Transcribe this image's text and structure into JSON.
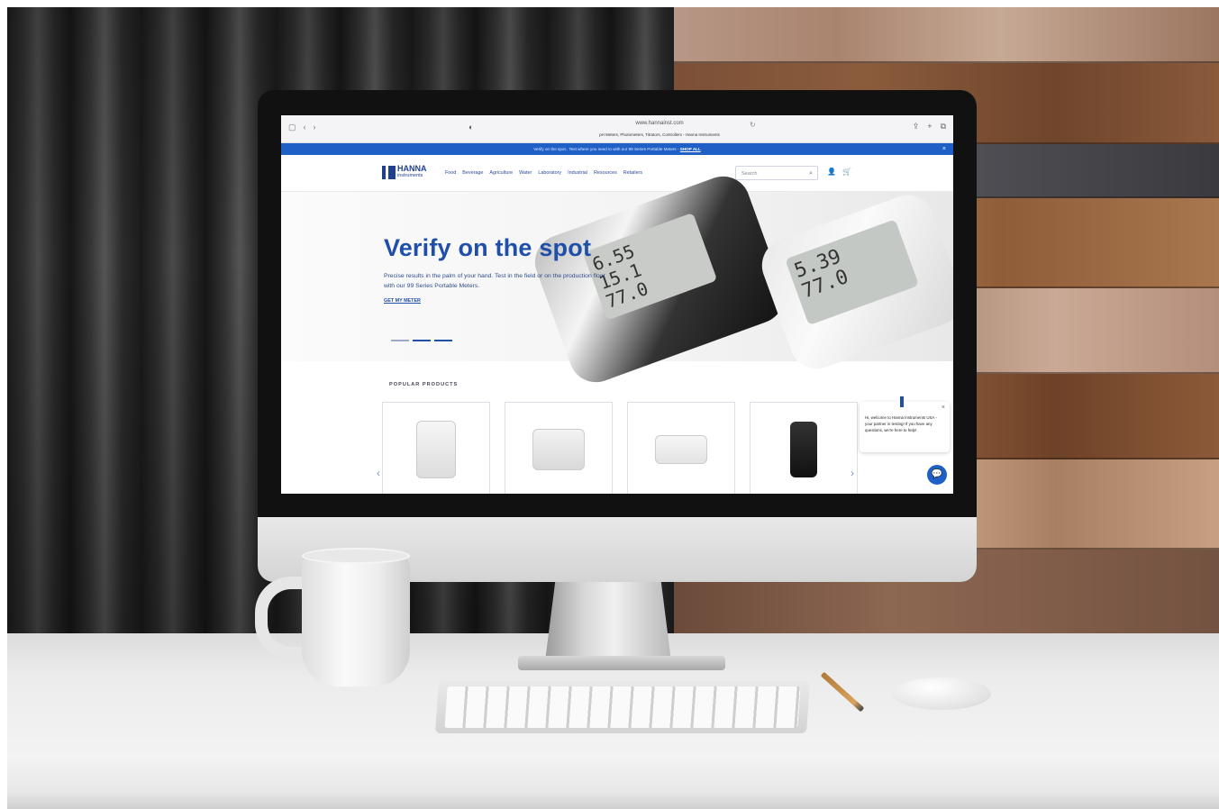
{
  "browser": {
    "url": "www.hannainst.com",
    "tab_title": "pH Meters, Photometers, Titrators, Controllers - Hanna Instruments",
    "nav_back": "‹",
    "nav_forward": "›",
    "sidebar_icon": "▢",
    "shield_icon": "◐",
    "reload_icon": "↻",
    "share_icon": "⇪",
    "new_tab_icon": "+",
    "tabs_icon": "⧉"
  },
  "promo": {
    "text": "Verify on the spot.. Test where you need to with our 99 Series Portable Meters - ",
    "link": "SHOP ALL",
    "close": "×"
  },
  "site": {
    "logo_text": "HANNA",
    "logo_sub": "instruments",
    "menu": [
      "Food",
      "Beverage",
      "Agriculture",
      "Water",
      "Laboratory",
      "Industrial",
      "Resources",
      "Retailers"
    ],
    "search_placeholder": "Search",
    "account_icon": "👤",
    "cart_icon": "🛒"
  },
  "hero": {
    "title": "Verify on the spot",
    "subtitle": "Precise results in the palm of your hand. Test in the field or on the production floor with our 99 Series Portable Meters.",
    "cta": "GET MY METER",
    "meter_a_reading": "6.55\n15.1\n77.0",
    "meter_b_reading": "5.39\n77.0"
  },
  "popular": {
    "label": "POPULAR PRODUCTS",
    "prev": "‹",
    "next": "›"
  },
  "chat": {
    "message": "Hi, welcome to Hanna Instruments USA - your partner in testing! If you have any questions, we're here to help!",
    "close": "×",
    "button_icon": "💬"
  }
}
